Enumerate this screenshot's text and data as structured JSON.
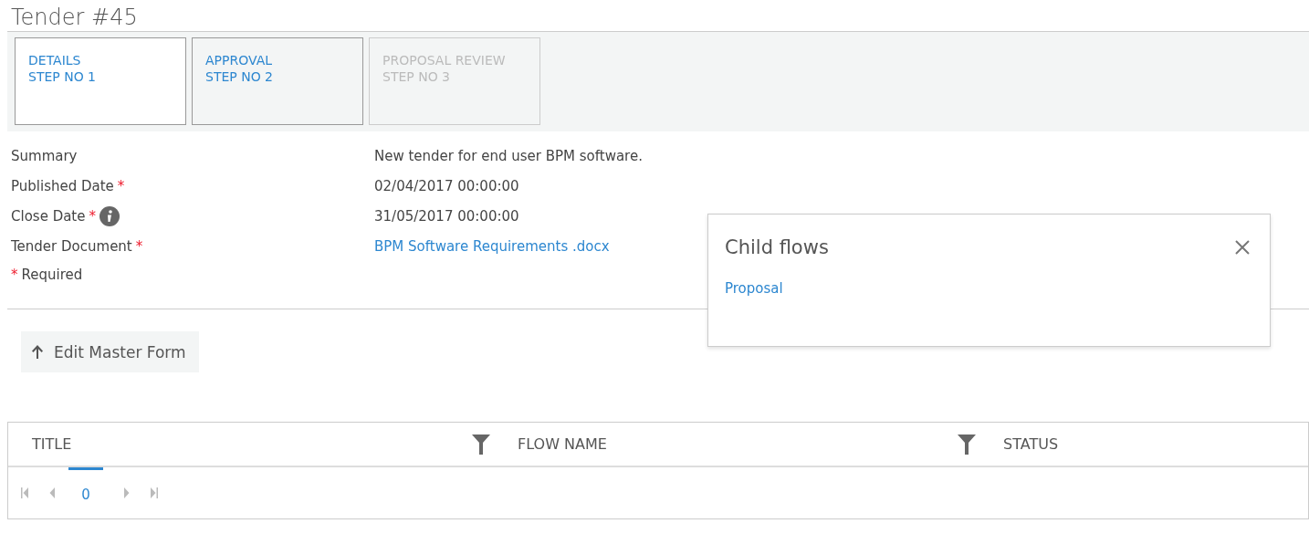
{
  "title": "Tender #45",
  "steps": [
    {
      "name": "DETAILS",
      "step": "STEP NO 1",
      "selected": true,
      "disabled": false
    },
    {
      "name": "APPROVAL",
      "step": "STEP NO 2",
      "selected": false,
      "disabled": false
    },
    {
      "name": "PROPOSAL REVIEW",
      "step": "STEP NO 3",
      "selected": false,
      "disabled": true
    }
  ],
  "fields": [
    {
      "label": "Summary",
      "required": false,
      "info": false,
      "kind": "text",
      "value": "New tender for end user BPM software."
    },
    {
      "label": "Published Date",
      "required": true,
      "info": false,
      "kind": "text",
      "value": "02/04/2017 00:00:00"
    },
    {
      "label": "Close Date",
      "required": true,
      "info": true,
      "kind": "text",
      "value": "31/05/2017 00:00:00"
    },
    {
      "label": "Tender Document",
      "required": true,
      "info": false,
      "kind": "link",
      "value": "BPM Software Requirements .docx"
    }
  ],
  "required_note": {
    "mark": "*",
    "text": "Required"
  },
  "edit_button": {
    "label": "Edit Master Form"
  },
  "popup": {
    "title": "Child flows",
    "links": [
      "Proposal"
    ]
  },
  "table": {
    "columns": [
      {
        "label": "TITLE",
        "filter": true
      },
      {
        "label": "FLOW NAME",
        "filter": true
      },
      {
        "label": "STATUS",
        "filter": false
      }
    ],
    "pager": {
      "pages": [
        {
          "label": "0",
          "selected": true
        }
      ]
    }
  }
}
